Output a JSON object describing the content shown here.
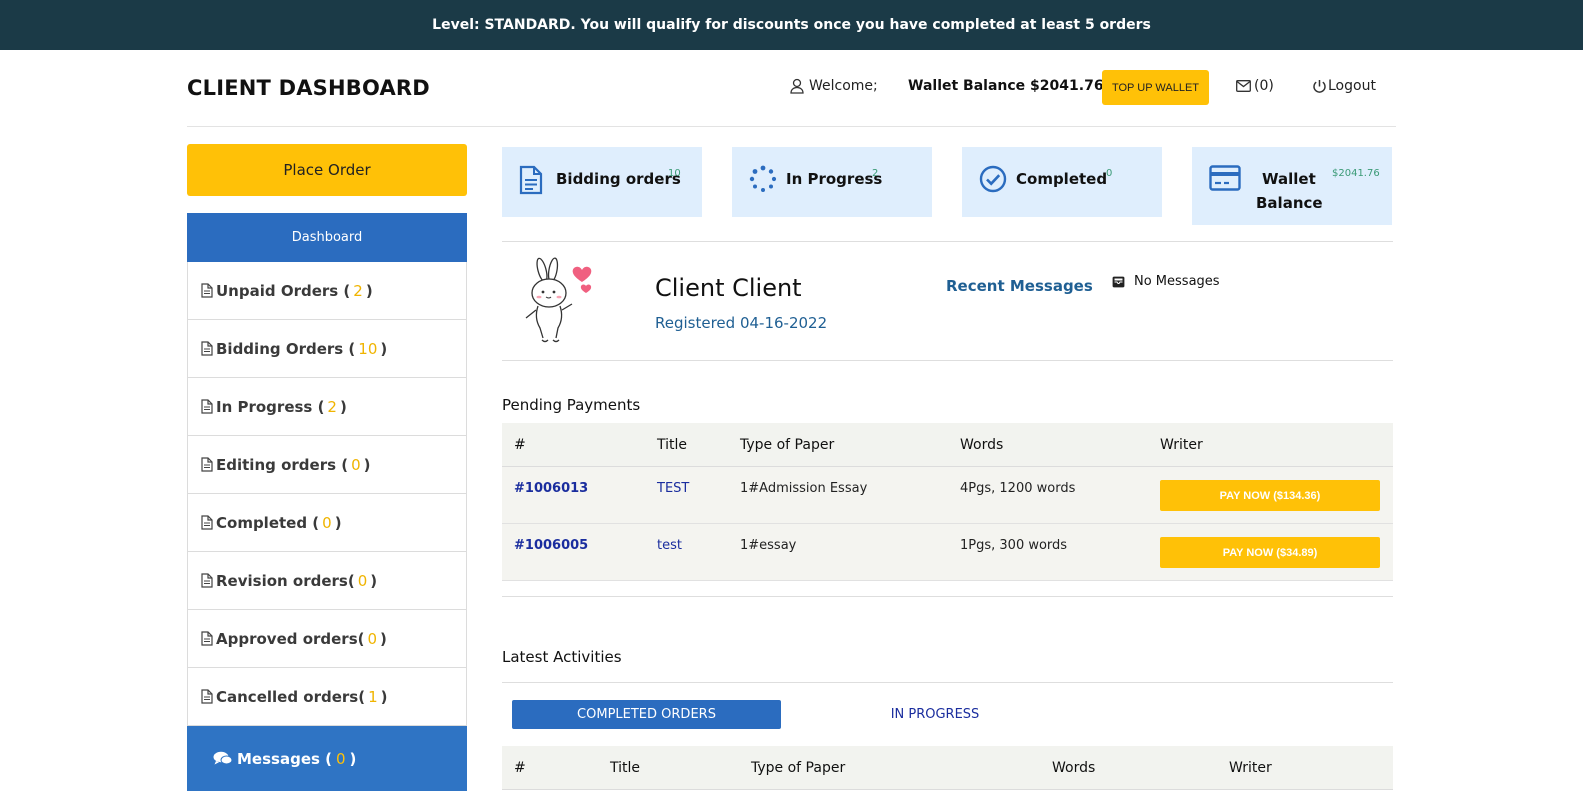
{
  "banner": {
    "text": "Level: STANDARD. You will qualify for discounts once you have completed at least 5 orders"
  },
  "header": {
    "title": "CLIENT DASHBOARD",
    "welcome": "Welcome;",
    "wallet_balance": "Wallet Balance $2041.76",
    "topup_label": "TOP UP WALLET",
    "mail_count": "(0)",
    "logout_label": "Logout"
  },
  "sidebar": {
    "place_order": "Place Order",
    "dashboard": "Dashboard",
    "items": [
      {
        "label": "Unpaid Orders (",
        "count": "2",
        "close": ")"
      },
      {
        "label": "Bidding Orders (",
        "count": "10",
        "close": ")"
      },
      {
        "label": "In Progress (",
        "count": "2",
        "close": ")"
      },
      {
        "label": "Editing orders (",
        "count": "0",
        "close": ")"
      },
      {
        "label": "Completed (",
        "count": "0",
        "close": ")"
      },
      {
        "label": "Revision orders(",
        "count": "0",
        "close": ")"
      },
      {
        "label": "Approved orders(",
        "count": "0",
        "close": ")"
      },
      {
        "label": "Cancelled orders(",
        "count": "1",
        "close": ")"
      }
    ],
    "messages": {
      "label": "Messages (",
      "count": "0",
      "close": ")"
    }
  },
  "stats": [
    {
      "label": "Bidding orders",
      "value": "10",
      "icon": "document-icon"
    },
    {
      "label": "In Progress",
      "value": "2",
      "icon": "spinner-icon"
    },
    {
      "label": "Completed",
      "value": "0",
      "icon": "check-circle-icon"
    },
    {
      "label_line1": "Wallet",
      "label_line2": "Balance",
      "value": "$2041.76",
      "icon": "credit-card-icon"
    }
  ],
  "profile": {
    "name": "Client Client",
    "registered": "Registered 04-16-2022",
    "recent_messages": "Recent Messages",
    "no_messages": "No Messages"
  },
  "pending": {
    "title": "Pending Payments",
    "headers": [
      "#",
      "Title",
      "Type of Paper",
      "Words",
      "Writer"
    ],
    "rows": [
      {
        "id": "#1006013",
        "title": "TEST",
        "type": "1#Admission Essay",
        "words": "4Pgs, 1200 words",
        "action": "PAY NOW ($134.36)"
      },
      {
        "id": "#1006005",
        "title": "test",
        "type": "1#essay",
        "words": "1Pgs, 300 words",
        "action": "PAY NOW ($34.89)"
      }
    ]
  },
  "activities": {
    "title": "Latest Activities",
    "tab_completed": "COMPLETED ORDERS",
    "tab_progress": "IN PROGRESS",
    "headers": [
      "#",
      "Title",
      "Type of Paper",
      "Words",
      "Writer"
    ]
  },
  "colors": {
    "banner": "#1b3a47",
    "accent": "#ffc107",
    "primary": "#2b6cbf",
    "link": "#1a2d9e"
  }
}
